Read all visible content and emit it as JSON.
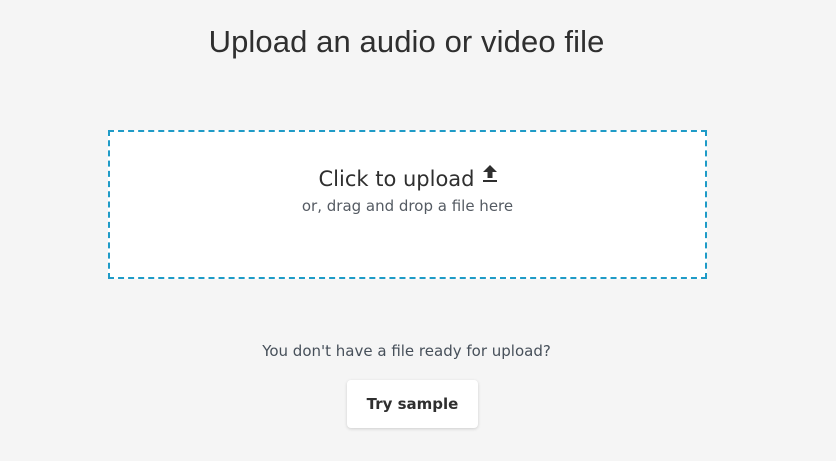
{
  "page": {
    "title": "Upload an audio or video file"
  },
  "dropzone": {
    "primary_label": "Click to upload",
    "secondary_label": "or, drag and drop a file here",
    "icon": "upload-icon",
    "border_color": "#1f9bc7"
  },
  "sample": {
    "prompt": "You don't have a file ready for upload?",
    "button_label": "Try sample"
  },
  "colors": {
    "background": "#f5f5f5",
    "text_primary": "#2f2f2f",
    "text_secondary": "#555b63"
  }
}
